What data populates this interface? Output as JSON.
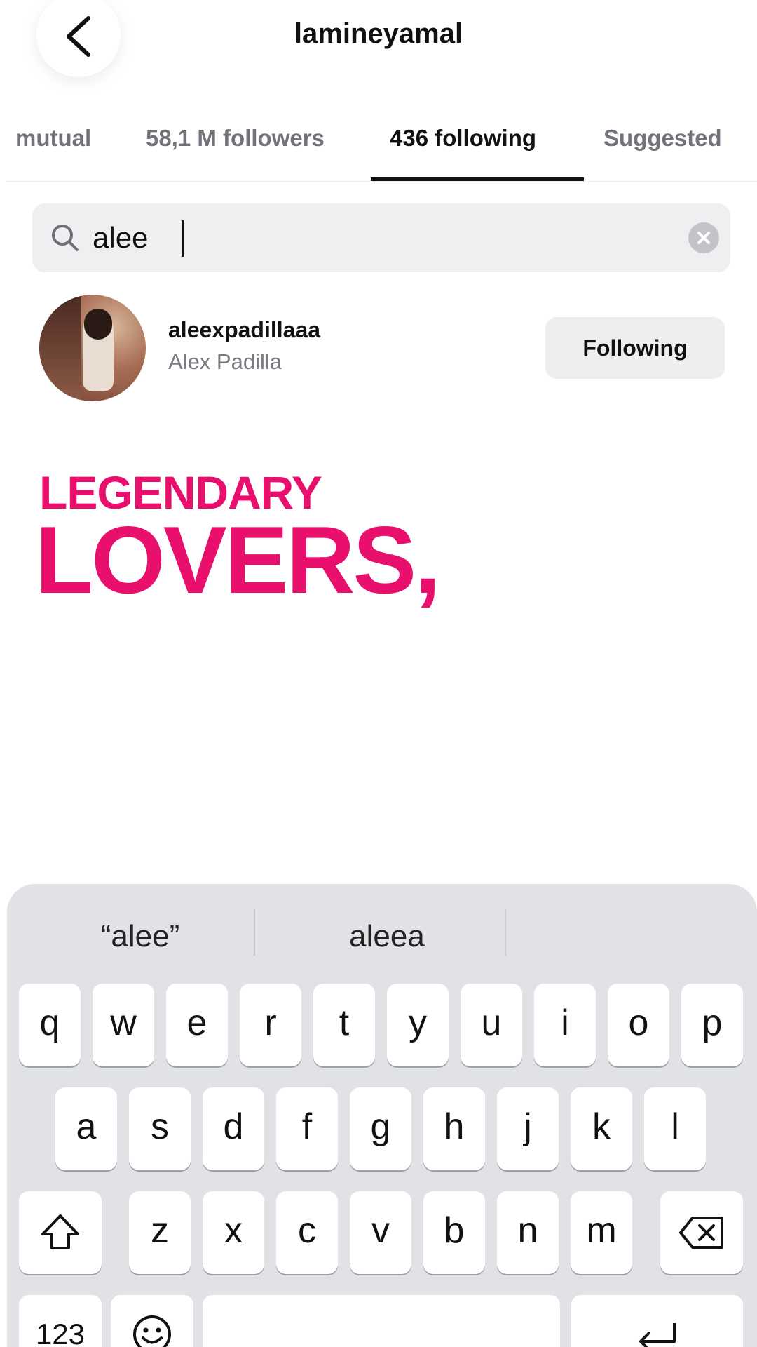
{
  "header": {
    "title": "lamineyamal",
    "back_icon": "chevron-left-icon"
  },
  "tabs": [
    {
      "label": "mutual",
      "active": false
    },
    {
      "label": "58,1 M followers",
      "active": false
    },
    {
      "label": "436 following",
      "active": true
    },
    {
      "label": "Suggested",
      "active": false
    }
  ],
  "search": {
    "value": "alee",
    "placeholder": "",
    "icon": "search-icon",
    "clear_icon": "clear-icon"
  },
  "results": [
    {
      "username": "aleexpadillaaa",
      "name": "Alex Padilla",
      "button_label": "Following"
    }
  ],
  "overlay": {
    "line1": "LEGENDARY",
    "line2": "LOVERS,",
    "color": "#e8106c"
  },
  "keyboard": {
    "suggestions": [
      "“alee”",
      "aleea"
    ],
    "row1": [
      "q",
      "w",
      "e",
      "r",
      "t",
      "y",
      "u",
      "i",
      "o",
      "p"
    ],
    "row2": [
      "a",
      "s",
      "d",
      "f",
      "g",
      "h",
      "j",
      "k",
      "l"
    ],
    "row3": [
      "z",
      "x",
      "c",
      "v",
      "b",
      "n",
      "m"
    ],
    "numbers_label": "123",
    "shift_icon": "shift-icon",
    "backspace_icon": "backspace-icon",
    "emoji_icon": "emoji-icon",
    "return_icon": "return-icon"
  }
}
